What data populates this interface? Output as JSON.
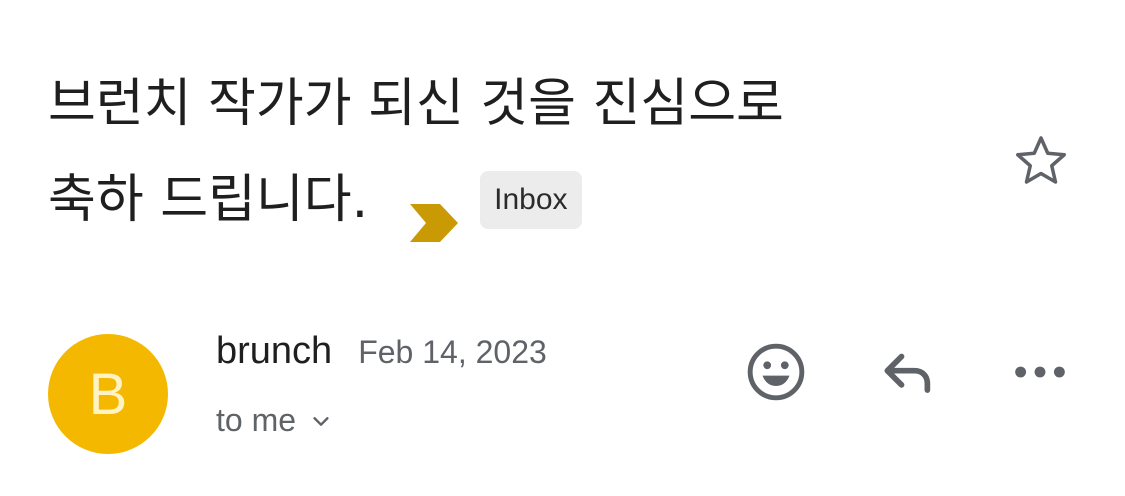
{
  "subject": {
    "line1": "브런치 작가가 되신 것을 진심으로",
    "line2": "축하 드립니다."
  },
  "label": "Inbox",
  "colors": {
    "importance_marker": "#c99a04",
    "avatar_bg": "#f5b800",
    "avatar_text": "#fff3c4",
    "icon_gray": "#5f6368"
  },
  "sender": {
    "initial": "B",
    "name": "brunch",
    "date": "Feb 14, 2023",
    "recipient": "to me"
  },
  "icons": {
    "star": "star-outline-icon",
    "emoji": "emoji-icon",
    "reply": "reply-icon",
    "more": "more-horizontal-icon",
    "expand": "chevron-down-icon",
    "important": "importance-marker-icon"
  }
}
